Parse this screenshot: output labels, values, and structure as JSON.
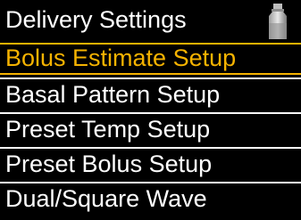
{
  "header": {
    "title": "Delivery Settings",
    "icon": "vial-icon"
  },
  "menu": {
    "items": [
      {
        "label": "Bolus Estimate Setup",
        "selected": true
      },
      {
        "label": "Basal Pattern Setup",
        "selected": false
      },
      {
        "label": "Preset Temp Setup",
        "selected": false
      },
      {
        "label": "Preset Bolus Setup",
        "selected": false
      },
      {
        "label": "Dual/Square Wave",
        "selected": false
      }
    ]
  },
  "colors": {
    "background": "#000000",
    "text": "#ffffff",
    "accent": "#f5b301"
  }
}
